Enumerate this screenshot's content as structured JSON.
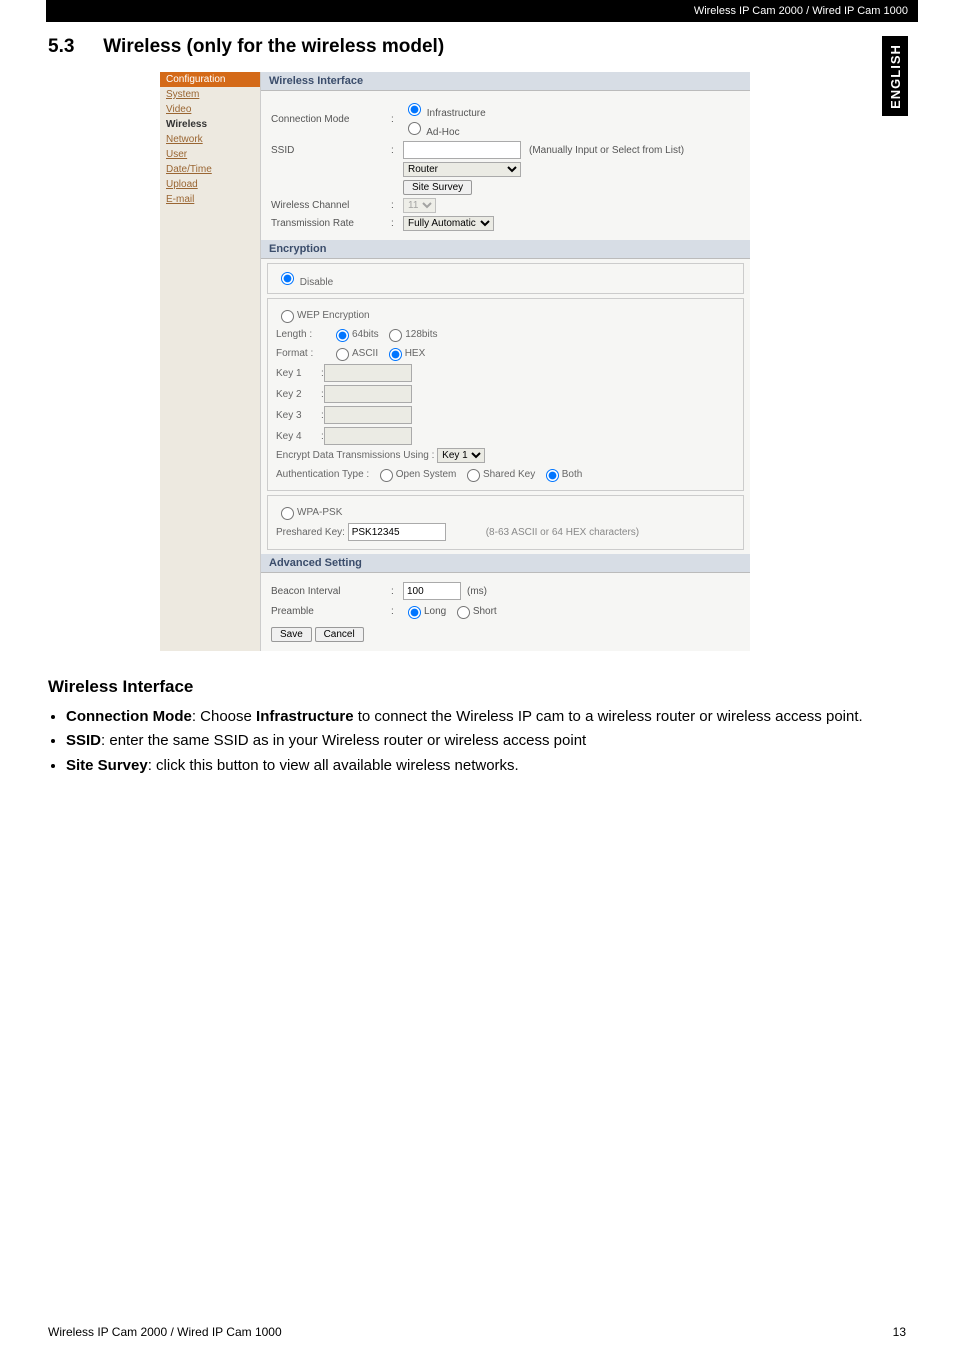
{
  "header": {
    "product_line": "Wireless IP Cam 2000 / Wired IP Cam 1000"
  },
  "side_tab": "ENGLISH",
  "section": {
    "number": "5.3",
    "title": "Wireless (only for the wireless model)"
  },
  "cfg_ui": {
    "sidebar": {
      "header": "Configuration",
      "items": [
        "System",
        "Video",
        "Wireless",
        "Network",
        "User",
        "Date/Time",
        "Upload",
        "E-mail"
      ],
      "active_index": 2
    },
    "wireless_interface": {
      "panel_title": "Wireless Interface",
      "connection_mode": {
        "label": "Connection Mode",
        "options": [
          "Infrastructure",
          "Ad-Hoc"
        ],
        "selected": "Infrastructure"
      },
      "ssid": {
        "label": "SSID",
        "value": "",
        "hint": "(Manually Input or Select from List)",
        "router_select": "Router",
        "site_survey_btn": "Site Survey"
      },
      "wireless_channel": {
        "label": "Wireless Channel",
        "value": "11"
      },
      "transmission_rate": {
        "label": "Transmission Rate",
        "value": "Fully Automatic"
      }
    },
    "encryption": {
      "panel_title": "Encryption",
      "disable_label": "Disable",
      "wep": {
        "label": "WEP Encryption",
        "length": {
          "label": "Length :",
          "options": [
            "64bits",
            "128bits"
          ],
          "selected": "64bits"
        },
        "format": {
          "label": "Format :",
          "options": [
            "ASCII",
            "HEX"
          ],
          "selected": "HEX"
        },
        "keys": [
          "Key 1",
          "Key 2",
          "Key 3",
          "Key 4"
        ],
        "encrypt_using": {
          "label": "Encrypt Data Transmissions Using :",
          "value": "Key 1"
        },
        "auth_type": {
          "label": "Authentication Type :",
          "options": [
            "Open System",
            "Shared Key",
            "Both"
          ],
          "selected": "Both"
        }
      },
      "wpa": {
        "label": "WPA-PSK",
        "preshared_key": {
          "label": "Preshared Key:",
          "value": "PSK12345",
          "hint": "(8-63 ASCII or 64 HEX characters)"
        }
      }
    },
    "advanced": {
      "panel_title": "Advanced Setting",
      "beacon": {
        "label": "Beacon Interval",
        "value": "100",
        "unit": "(ms)"
      },
      "preamble": {
        "label": "Preamble",
        "options": [
          "Long",
          "Short"
        ],
        "selected": "Long"
      }
    },
    "buttons": {
      "save": "Save",
      "cancel": "Cancel"
    }
  },
  "body_section": {
    "heading": "Wireless Interface",
    "bullets": [
      {
        "prefix_bold": "Connection Mode",
        "after_prefix": ": Choose ",
        "bold2": "Infrastructure",
        "rest": " to connect the Wireless IP cam to a wireless router or wireless access point."
      },
      {
        "prefix_bold": "SSID",
        "after_prefix": ": enter the same SSID as in your Wireless router or wireless access point",
        "bold2": "",
        "rest": ""
      },
      {
        "prefix_bold": "Site Survey",
        "after_prefix": ": click this button to view all available wireless networks.",
        "bold2": "",
        "rest": ""
      }
    ]
  },
  "footer": {
    "left": "Wireless IP Cam 2000 / Wired IP Cam 1000",
    "right": "13"
  }
}
